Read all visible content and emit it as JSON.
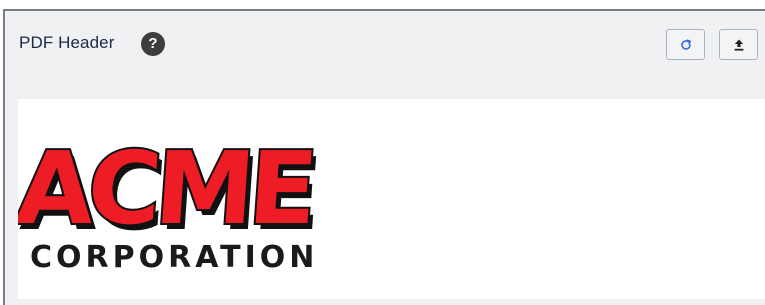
{
  "panel": {
    "title": "PDF Header",
    "help_icon_glyph": "?"
  },
  "toolbar": {
    "refresh_icon": "refresh-icon",
    "upload_icon": "upload-icon"
  },
  "logo": {
    "word_main": "ACME",
    "word_sub": "CORPORATION",
    "colors": {
      "fill": "#ee1c25",
      "outline": "#111111"
    }
  }
}
